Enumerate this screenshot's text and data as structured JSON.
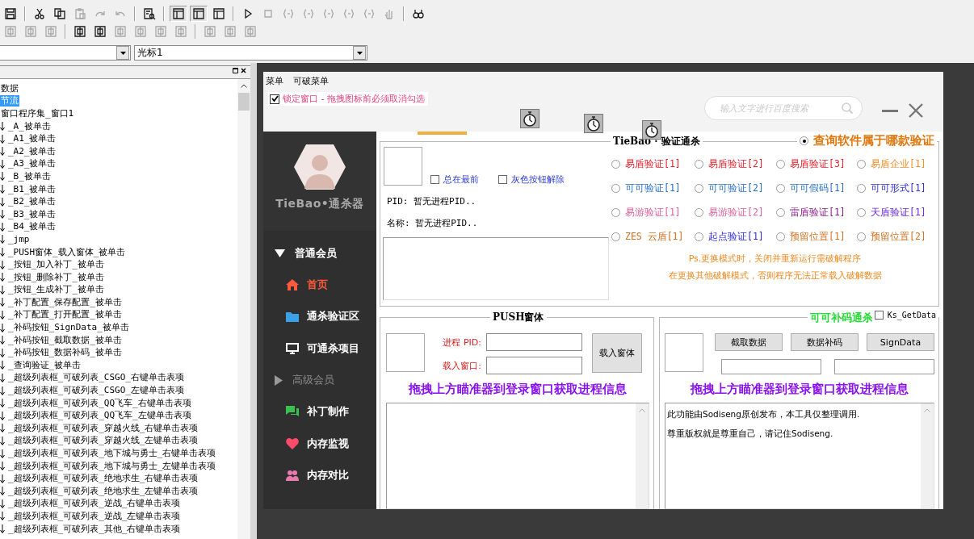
{
  "toolbar_rows": [
    [
      {
        "kind": "save",
        "disabled": false
      },
      {
        "kind": "separator"
      },
      {
        "kind": "cut",
        "disabled": false
      },
      {
        "kind": "copy",
        "disabled": false
      },
      {
        "kind": "paste",
        "disabled": true
      },
      {
        "kind": "redo",
        "disabled": true
      },
      {
        "kind": "undo",
        "disabled": true
      },
      {
        "kind": "separator"
      },
      {
        "kind": "preview",
        "disabled": false
      },
      {
        "kind": "separator"
      },
      {
        "kind": "layout",
        "disabled": false,
        "selected": true
      },
      {
        "kind": "layout",
        "disabled": false,
        "selected": true
      },
      {
        "kind": "layout",
        "disabled": false,
        "selected": false
      },
      {
        "kind": "separator"
      },
      {
        "kind": "run",
        "disabled": false
      },
      {
        "kind": "stop",
        "disabled": true
      },
      {
        "kind": "step",
        "disabled": true
      },
      {
        "kind": "step",
        "disabled": true
      },
      {
        "kind": "step",
        "disabled": true
      },
      {
        "kind": "step",
        "disabled": true
      },
      {
        "kind": "step",
        "disabled": true
      },
      {
        "kind": "hand",
        "disabled": true
      },
      {
        "kind": "separator"
      },
      {
        "kind": "find",
        "disabled": false
      }
    ],
    [
      {
        "kind": "align",
        "disabled": true
      },
      {
        "kind": "align",
        "disabled": true
      },
      {
        "kind": "align",
        "disabled": true
      },
      {
        "kind": "separator"
      },
      {
        "kind": "align",
        "disabled": false
      },
      {
        "kind": "align",
        "disabled": false
      },
      {
        "kind": "align",
        "disabled": true
      },
      {
        "kind": "align",
        "disabled": true
      },
      {
        "kind": "align",
        "disabled": true
      },
      {
        "kind": "align",
        "disabled": true
      },
      {
        "kind": "separator"
      },
      {
        "kind": "align",
        "disabled": true
      },
      {
        "kind": "align",
        "disabled": true
      },
      {
        "kind": "align",
        "disabled": true
      }
    ]
  ],
  "combo_right": {
    "value": "光标1"
  },
  "tree": [
    {
      "label": "数据",
      "selected": false
    },
    {
      "label": "节流",
      "selected": true
    },
    {
      "label": "窗口程序集_窗口1",
      "selected": false,
      "children": [
        {
          "label": "_A_被单击",
          "selected": false
        },
        {
          "label": "_A1_被单击",
          "selected": false
        },
        {
          "label": "_A2_被单击",
          "selected": false
        },
        {
          "label": "_A3_被单击",
          "selected": false
        },
        {
          "label": "_B_被单击",
          "selected": false
        },
        {
          "label": "_B1_被单击",
          "selected": false
        },
        {
          "label": "_B2_被单击",
          "selected": false
        },
        {
          "label": "_B3_被单击",
          "selected": false
        },
        {
          "label": "_B4_被单击",
          "selected": false
        },
        {
          "label": "_jmp",
          "selected": false
        },
        {
          "label": "_PUSH窗体_载入窗体_被单击",
          "selected": false
        },
        {
          "label": "_按钮_加入补丁_被单击",
          "selected": false
        },
        {
          "label": "_按钮_删除补丁_被单击",
          "selected": false
        },
        {
          "label": "_按钮_生成补丁_被单击",
          "selected": false
        },
        {
          "label": "_补丁配置_保存配置_被单击",
          "selected": false
        },
        {
          "label": "_补丁配置_打开配置_被单击",
          "selected": false
        },
        {
          "label": "_补码按钮_SignData_被单击",
          "selected": false
        },
        {
          "label": "_补码按钮_截取数据_被单击",
          "selected": false
        },
        {
          "label": "_补码按钮_数据补码_被单击",
          "selected": false
        },
        {
          "label": "_查询验证_被单击",
          "selected": false
        },
        {
          "label": "_超级列表框_可破列表_CSGO_右键单击表项",
          "selected": false
        },
        {
          "label": "_超级列表框_可破列表_CSGO_左键单击表项",
          "selected": false
        },
        {
          "label": "_超级列表框_可破列表_QQ飞车_右键单击表项",
          "selected": false
        },
        {
          "label": "_超级列表框_可破列表_QQ飞车_左键单击表项",
          "selected": false
        },
        {
          "label": "_超级列表框_可破列表_穿越火线_右键单击表项",
          "selected": false
        },
        {
          "label": "_超级列表框_可破列表_穿越火线_左键单击表项",
          "selected": false
        },
        {
          "label": "_超级列表框_可破列表_地下城与勇士_右键单击表项",
          "selected": false
        },
        {
          "label": "_超级列表框_可破列表_地下城与勇士_左键单击表项",
          "selected": false
        },
        {
          "label": "_超级列表框_可破列表_绝地求生_右键单击表项",
          "selected": false
        },
        {
          "label": "_超级列表框_可破列表_绝地求生_左键单击表项",
          "selected": false
        },
        {
          "label": "_超级列表框_可破列表_逆战_右键单击表项",
          "selected": false
        },
        {
          "label": "_超级列表框_可破列表_逆战_左键单击表项",
          "selected": false
        },
        {
          "label": "_超级列表框_可破列表_其他_右键单击表项",
          "selected": false
        }
      ]
    }
  ],
  "form": {
    "menu": [
      "菜单",
      "可破菜单"
    ],
    "lock_checkbox": {
      "label": "锁定窗口 - 拖拽图标前必须取消勾选",
      "checked": true
    },
    "search": {
      "placeholder": "输入文字进行百度搜索"
    },
    "sidebar": {
      "title": "TieBao•通杀器",
      "items": [
        {
          "kind": "group",
          "label": "普通会员",
          "expanded": true
        },
        {
          "kind": "item",
          "label": "首页",
          "selected": true
        },
        {
          "kind": "item",
          "label": "通杀验证区",
          "selected": false
        },
        {
          "kind": "item",
          "label": "可通杀项目",
          "selected": false
        },
        {
          "kind": "group",
          "label": "高级会员",
          "expanded": false
        },
        {
          "kind": "item",
          "label": "补丁制作",
          "selected": false
        },
        {
          "kind": "item",
          "label": "内存监视",
          "selected": false
        },
        {
          "kind": "item",
          "label": "内存对比",
          "selected": false
        }
      ]
    },
    "top_panel": {
      "checkboxes": [
        {
          "label": "总在最前",
          "checked": false
        },
        {
          "label": "灰色按钮解除",
          "checked": false
        }
      ],
      "pid_line": "PID: 暂无进程PID..",
      "name_line": "名称: 暂无进程PID..",
      "group_title": "TieBao · 验证通杀",
      "query_radio": {
        "label": "查询软件属于哪款验证",
        "selected": true
      },
      "radios": [
        {
          "label": "易盾验证[1]",
          "color": "#e8202a",
          "selected": false
        },
        {
          "label": "易盾验证[2]",
          "color": "#e8202a",
          "selected": false
        },
        {
          "label": "易盾验证[3]",
          "color": "#e8202a",
          "selected": false
        },
        {
          "label": "易盾企业[1]",
          "color": "#f0902a",
          "selected": false
        },
        {
          "label": "可可验证[1]",
          "color": "#2a70c8",
          "selected": false
        },
        {
          "label": "可可验证[2]",
          "color": "#2a70c8",
          "selected": false
        },
        {
          "label": "可可假码[1]",
          "color": "#2a70c8",
          "selected": false
        },
        {
          "label": "可可形式[1]",
          "color": "#3030d0",
          "selected": false
        },
        {
          "label": "易游验证[1]",
          "color": "#e0609a",
          "selected": false
        },
        {
          "label": "易游验证[2]",
          "color": "#e0609a",
          "selected": false
        },
        {
          "label": "雷盾验证[1]",
          "color": "#8a1a8a",
          "selected": false
        },
        {
          "label": "天盾验证[1]",
          "color": "#6a2ae0",
          "selected": false
        },
        {
          "label": "ZES 云盾[1]",
          "color": "#d07020",
          "selected": false
        },
        {
          "label": "起点验证[1]",
          "color": "#2a2ae0",
          "selected": false
        },
        {
          "label": "预留位置[1]",
          "color": "#d07020",
          "selected": false
        },
        {
          "label": "预留位置[2]",
          "color": "#d07020",
          "selected": false
        }
      ],
      "notes": [
        "Ps.更换模式时，关闭并重新运行需破解程序",
        "在更换其他破解模式，否则程序无法正常载入破解数据"
      ]
    },
    "push_panel": {
      "title": "PUSH窗体",
      "pid_label": "进程 PID:",
      "window_label": "载入窗口:",
      "load_button": "载入窗体",
      "hint": "拖拽上方瞄准器到登录窗口获取进程信息"
    },
    "patch_panel": {
      "title": "可可补码通杀",
      "getdata_checkbox": {
        "label": "Ks_GetData",
        "checked": false
      },
      "buttons": [
        "截取数据",
        "数据补码",
        "SignData"
      ],
      "hint": "拖拽上方瞄准器到登录窗口获取进程信息",
      "log_lines": [
        "此功能由Sodiseng原创发布，本工具仅整理调用.",
        "尊重版权就是尊重自己，请记住Sodiseng."
      ]
    }
  }
}
